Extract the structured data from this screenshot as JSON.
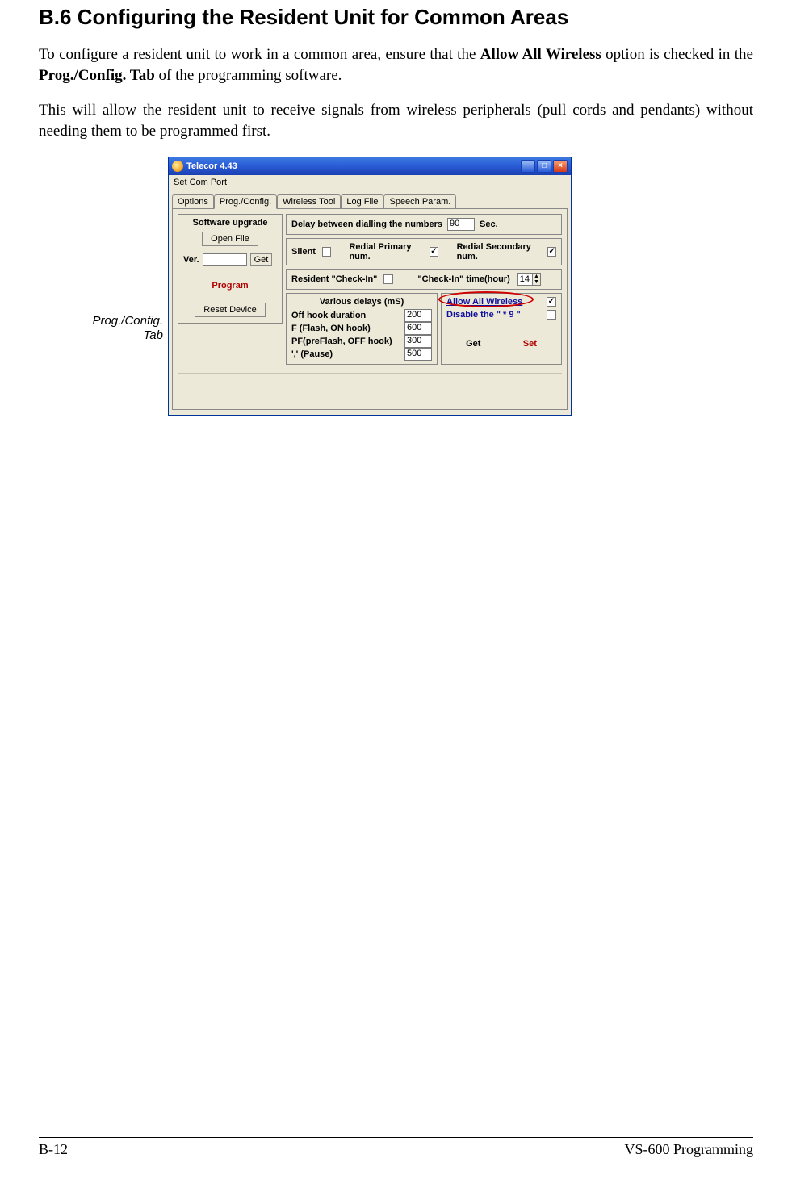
{
  "heading": "B.6    Configuring the Resident Unit for Common Areas",
  "para1_a": "To configure a resident unit to work in a common area, ensure that the ",
  "para1_bold1": "Allow All Wireless",
  "para1_b": " option is checked in the ",
  "para1_bold2": "Prog./Config. Tab",
  "para1_c": " of the programming software.",
  "para2": "This will allow the resident unit to receive signals from wireless peripherals (pull cords and pendants) without needing them to be programmed first.",
  "caption_line1": "Prog./Config.",
  "caption_line2": "Tab",
  "window": {
    "title": "Telecor 4.43",
    "menu": "Set Com Port",
    "tabs": {
      "options": "Options",
      "prog": "Prog./Config.",
      "wireless": "Wireless Tool",
      "log": "Log File",
      "speech": "Speech Param."
    },
    "left": {
      "sw_upgrade": "Software upgrade",
      "open_file": "Open File",
      "ver_label": "Ver.",
      "get_btn": "Get",
      "program": "Program",
      "reset": "Reset Device"
    },
    "row1": {
      "delay_label": "Delay between dialling the numbers",
      "delay_value": "90",
      "sec": "Sec."
    },
    "row2": {
      "silent": "Silent",
      "redial_primary": "Redial Primary num.",
      "redial_secondary": "Redial Secondary num."
    },
    "row3": {
      "resident_checkin": "Resident \"Check-In\"",
      "checkin_time": "\"Check-In\" time(hour)",
      "checkin_value": "14"
    },
    "delays": {
      "header": "Various delays (mS)",
      "off_hook": "Off hook duration",
      "off_hook_v": "200",
      "flash": "F (Flash, ON hook)",
      "flash_v": "600",
      "preflash": "PF(preFlash, OFF hook)",
      "preflash_v": "300",
      "pause": "',' (Pause)",
      "pause_v": "500"
    },
    "options": {
      "allow_wireless": "Allow All Wireless",
      "disable_star9": "Disable the \" * 9 \""
    },
    "get": "Get",
    "set": "Set"
  },
  "footer": {
    "left": "B-12",
    "right": "VS-600 Programming"
  },
  "win_btns": {
    "min": "_",
    "max": "□",
    "close": "×"
  }
}
